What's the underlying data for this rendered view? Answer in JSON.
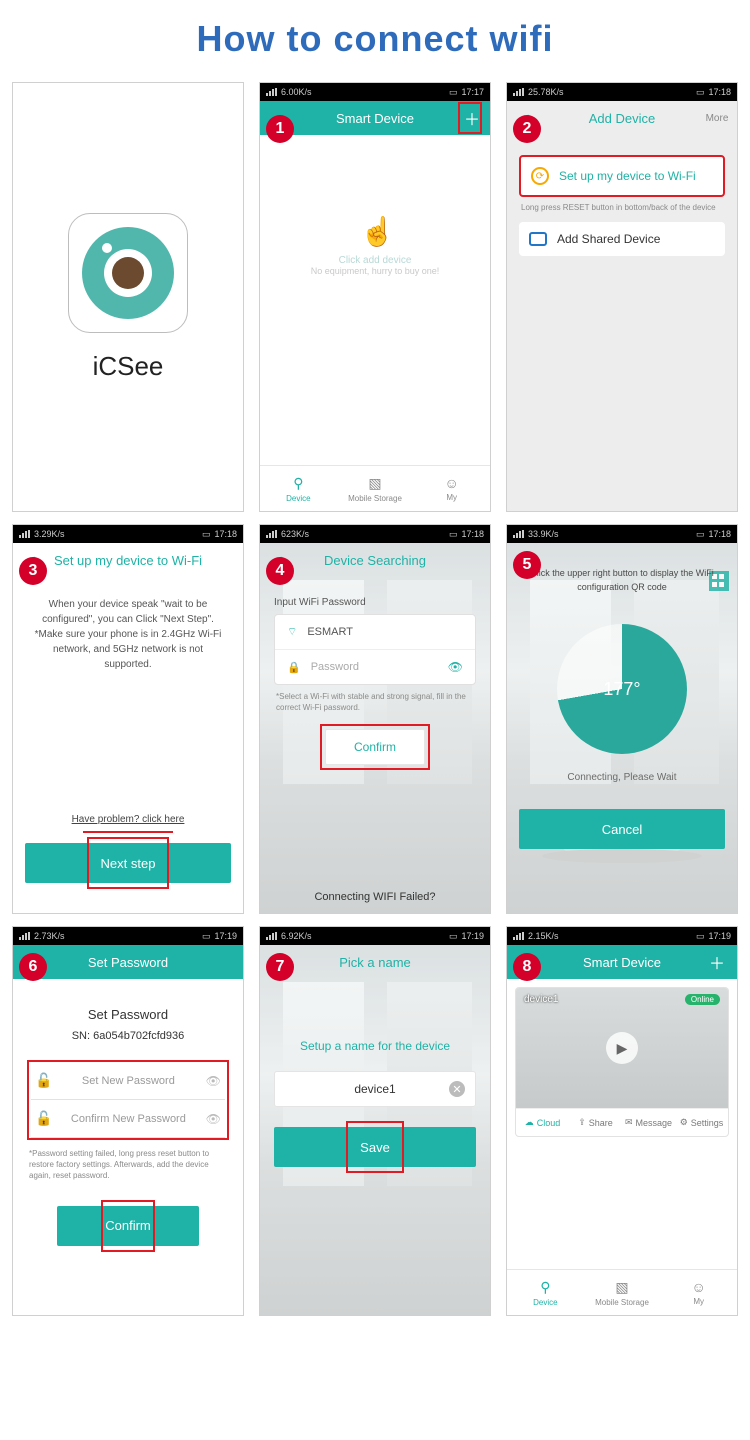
{
  "title": "How to connect wifi",
  "status_times": {
    "s1": "17:17",
    "s2": "17:18",
    "s3": "17:18",
    "s4": "17:18",
    "s5": "17:18",
    "s6": "17:19",
    "s7": "17:19",
    "s8": "17:19"
  },
  "status_net": {
    "s1": "6.00K/s",
    "s2": "25.78K/s",
    "s3": "3.29K/s",
    "s4": "623K/s",
    "s5": "33.9K/s",
    "s6": "2.73K/s",
    "s7": "6.92K/s",
    "s8": "2.15K/s"
  },
  "icsee": {
    "name": "iCSee"
  },
  "screen1": {
    "header": "Smart Device",
    "click_add": "Click add device",
    "no_equip": "No equipment, hurry to buy one!",
    "tabs": {
      "device": "Device",
      "storage": "Mobile Storage",
      "my": "My"
    }
  },
  "screen2": {
    "header": "Add Device",
    "more": "More",
    "opt_wifi": "Set up my device to Wi-Fi",
    "opt_wifi_hint": "Long press RESET button in bottom/back of the device",
    "opt_shared": "Add Shared Device"
  },
  "screen3": {
    "header": "Set up my device to Wi-Fi",
    "body": "When your device speak \"wait to be configured\", you can Click \"Next Step\". *Make sure your phone is in 2.4GHz Wi-Fi network, and 5GHz network is not supported.",
    "problem": "Have problem? click here",
    "next": "Next step"
  },
  "screen4": {
    "header": "Device Searching",
    "label": "Input WiFi Password",
    "ssid": "ESMART",
    "pwd_ph": "Password",
    "hint": "*Select a Wi-Fi with stable and strong signal, fill in the correct Wi-Fi password.",
    "confirm": "Confirm",
    "fail": "Connecting WIFI Failed?"
  },
  "screen5": {
    "tip": "Click the upper right button to display the WiFi configuration QR code",
    "angle": "177°",
    "connecting": "Connecting, Please Wait",
    "cancel": "Cancel"
  },
  "screen6": {
    "header": "Set Password",
    "h": "Set Password",
    "sn_label": "SN: 6a054b702fcfd936",
    "new_pw": "Set New Password",
    "confirm_pw": "Confirm New Password",
    "note": "*Password setting failed, long press reset button to restore factory settings. Afterwards, add the device again, reset password.",
    "confirm": "Confirm"
  },
  "screen7": {
    "header": "Pick a name",
    "h": "Setup a name for the device",
    "value": "device1",
    "save": "Save"
  },
  "screen8": {
    "header": "Smart Device",
    "device_name": "device1",
    "online": "Online",
    "actions": {
      "cloud": "Cloud",
      "share": "Share",
      "msg": "Message",
      "settings": "Settings"
    },
    "tabs": {
      "device": "Device",
      "storage": "Mobile Storage",
      "my": "My"
    }
  }
}
